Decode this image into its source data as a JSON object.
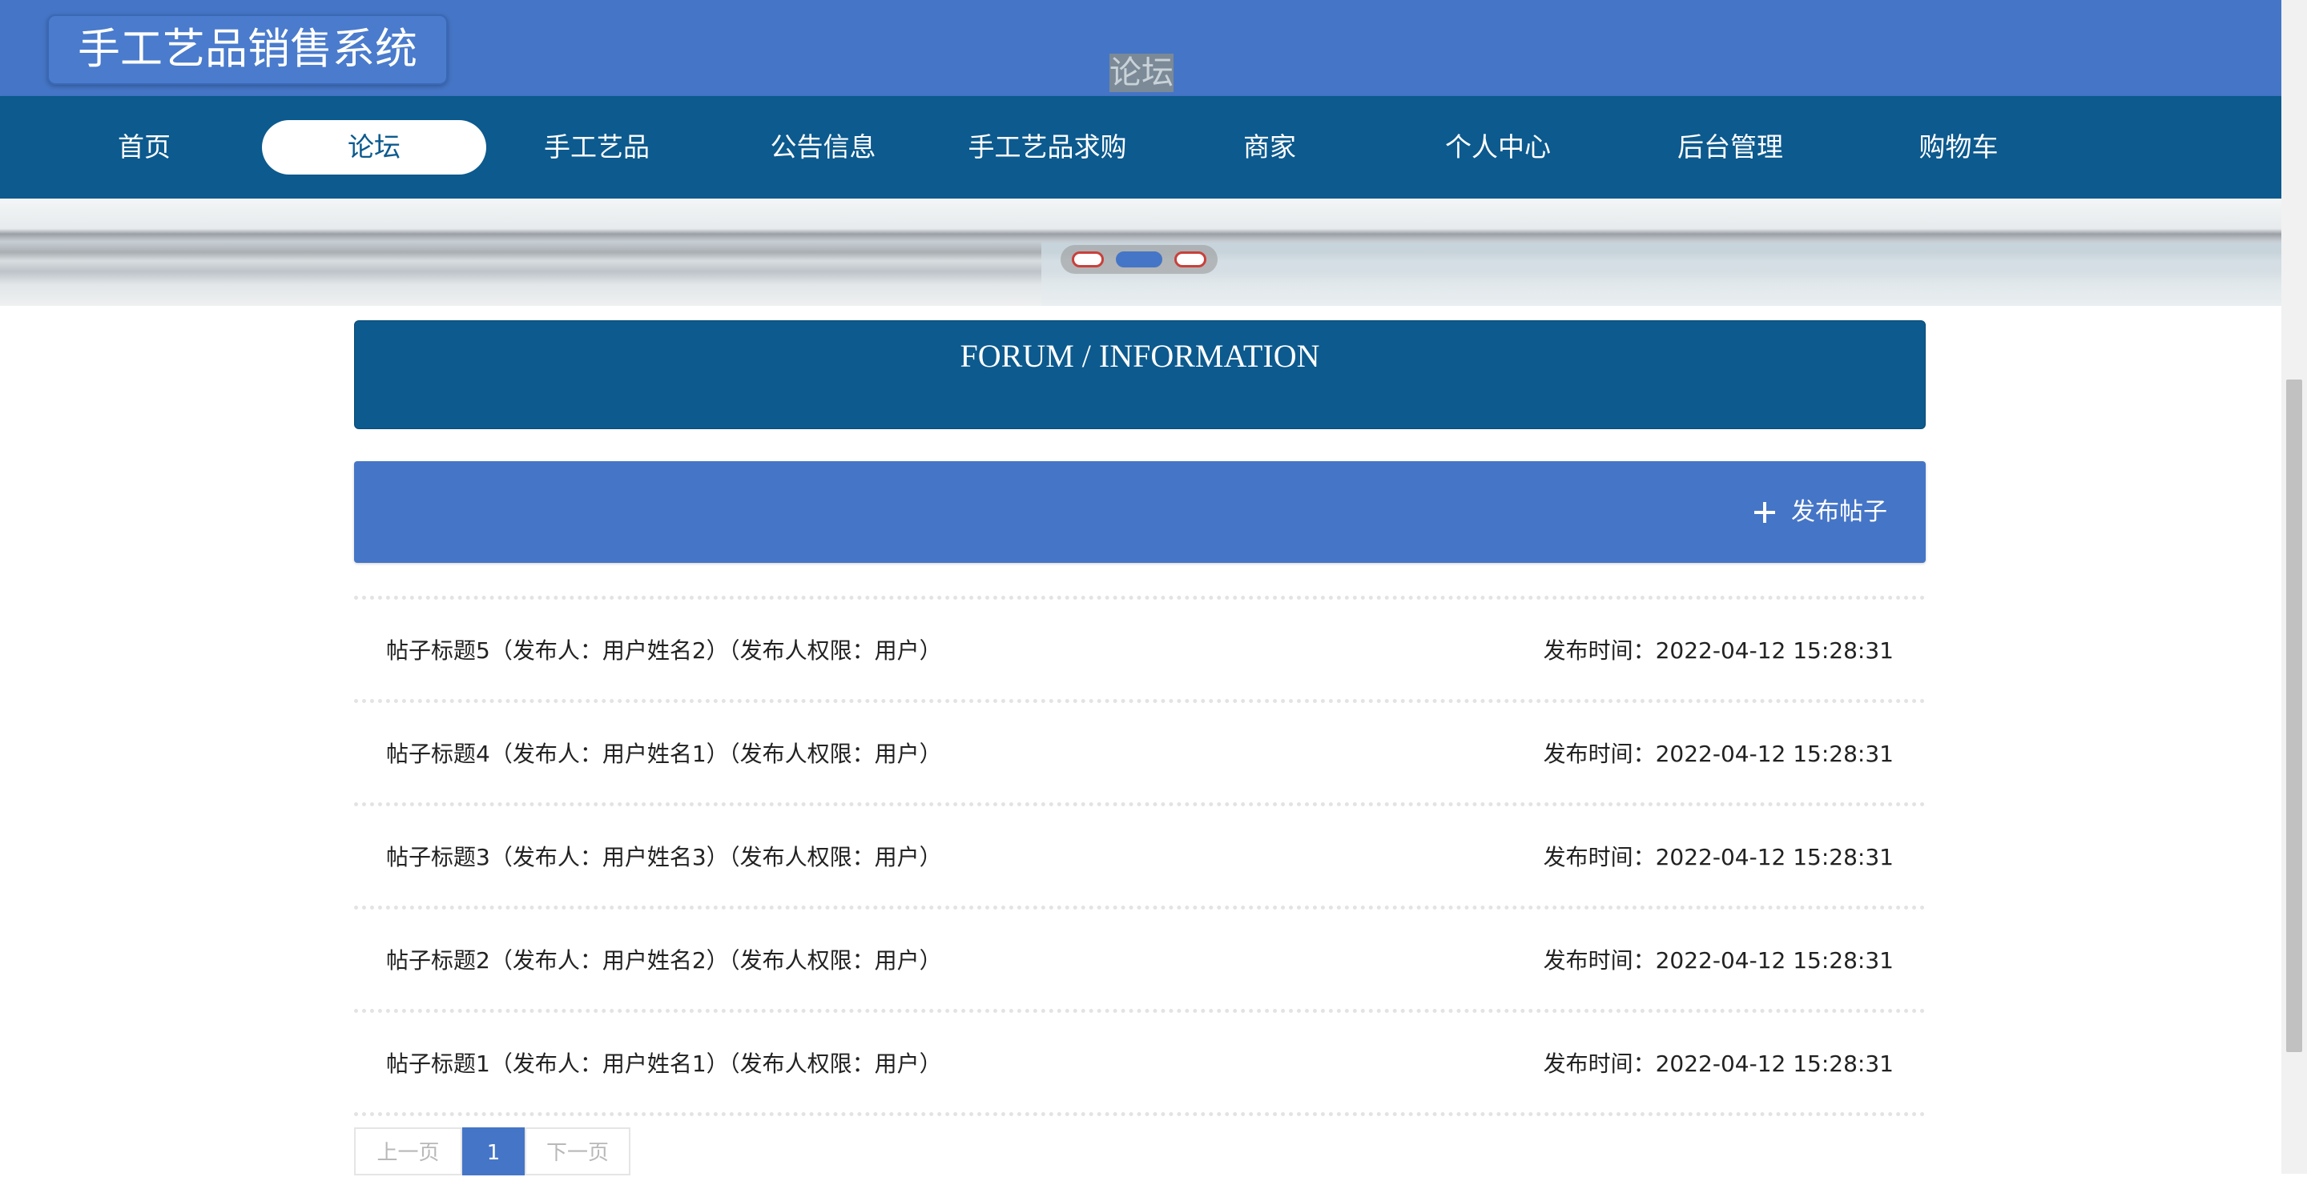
{
  "header": {
    "title": "手工艺品销售系统"
  },
  "nav": [
    {
      "label": "首页",
      "active": false
    },
    {
      "label": "论坛",
      "active": true
    },
    {
      "label": "手工艺品",
      "active": false
    },
    {
      "label": "公告信息",
      "active": false
    },
    {
      "label": "手工艺品求购",
      "active": false
    },
    {
      "label": "商家",
      "active": false
    },
    {
      "label": "个人中心",
      "active": false
    },
    {
      "label": "后台管理",
      "active": false
    },
    {
      "label": "购物车",
      "active": false
    }
  ],
  "banner": {
    "slide_count": 3,
    "active_slide": 2
  },
  "section": {
    "title_en": "FORUM / INFORMATION",
    "title_cn": "论坛"
  },
  "actions": {
    "new_post_label": "发布帖子",
    "new_post_icon": "plus-icon"
  },
  "posts": [
    {
      "title": "帖子标题5（发布人：用户姓名2）（发布人权限：用户）",
      "time": "发布时间：2022-04-12 15:28:31"
    },
    {
      "title": "帖子标题4（发布人：用户姓名1）（发布人权限：用户）",
      "time": "发布时间：2022-04-12 15:28:31"
    },
    {
      "title": "帖子标题3（发布人：用户姓名3）（发布人权限：用户）",
      "time": "发布时间：2022-04-12 15:28:31"
    },
    {
      "title": "帖子标题2（发布人：用户姓名2）（发布人权限：用户）",
      "time": "发布时间：2022-04-12 15:28:31"
    },
    {
      "title": "帖子标题1（发布人：用户姓名1）（发布人权限：用户）",
      "time": "发布时间：2022-04-12 15:28:31"
    }
  ],
  "pagination": {
    "prev": "上一页",
    "current": "1",
    "next": "下一页"
  },
  "colors": {
    "primary": "#4575c6",
    "nav_bg": "#0c5a8e"
  }
}
